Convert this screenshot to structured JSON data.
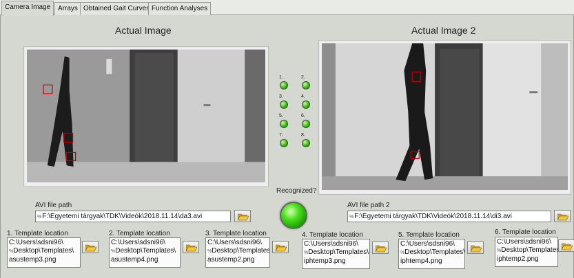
{
  "tabs": [
    {
      "label": "Camera Image",
      "active": true
    },
    {
      "label": "Arrays",
      "active": false
    },
    {
      "label": "Obtained Gait Curves",
      "active": false
    },
    {
      "label": "Function Analyses",
      "active": false
    }
  ],
  "image1": {
    "title": "Actual Image"
  },
  "image2": {
    "title": "Actual Image 2"
  },
  "leds": [
    "1.",
    "2.",
    "3.",
    "4.",
    "5.",
    "6.",
    "7.",
    "8."
  ],
  "recognized": {
    "label": "Recognized?",
    "state": "on",
    "color": "#3fd11a"
  },
  "avi1": {
    "label": "AVI file path",
    "prefix": "%",
    "value": "F:\\Egyetemi tárgyak\\TDK\\Videók\\2018.11.14\\da3.avi"
  },
  "avi2": {
    "label": "AVI file path 2",
    "prefix": "%",
    "value": "F:\\Egyetemi tárgyak\\TDK\\Videók\\2018.11.14\\di3.avi"
  },
  "templates": [
    {
      "label": "1. Template location",
      "line1": "C:\\Users\\sdsni96\\",
      "prefix": "%",
      "line2": "Desktop\\Templates\\",
      "line3": "asustemp3.png"
    },
    {
      "label": "2. Template location",
      "line1": "C:\\Users\\sdsni96\\",
      "prefix": "%",
      "line2": "Desktop\\Templates\\",
      "line3": "asustemp4.png"
    },
    {
      "label": "3. Template location",
      "line1": "C:\\Users\\sdsni96\\",
      "prefix": "%",
      "line2": "Desktop\\Templates\\",
      "line3": "asustemp2.png"
    },
    {
      "label": "4. Template location",
      "line1": "C:\\Users\\sdsni96\\",
      "prefix": "%",
      "line2": "Desktop\\Templates\\",
      "line3": "iphtemp3.png"
    },
    {
      "label": "5. Template location",
      "line1": "C:\\Users\\sdsni96\\",
      "prefix": "%",
      "line2": "Desktop\\Templates\\",
      "line3": "iphtemp4.png"
    },
    {
      "label": "6. Template location",
      "line1": "C:\\Users\\sdsni96\\",
      "prefix": "%",
      "line2": "Desktop\\Templates\\",
      "line3": "iphtemp2.png"
    }
  ],
  "icons": {
    "browse": "folder-open-icon",
    "led": "green-led-icon"
  }
}
